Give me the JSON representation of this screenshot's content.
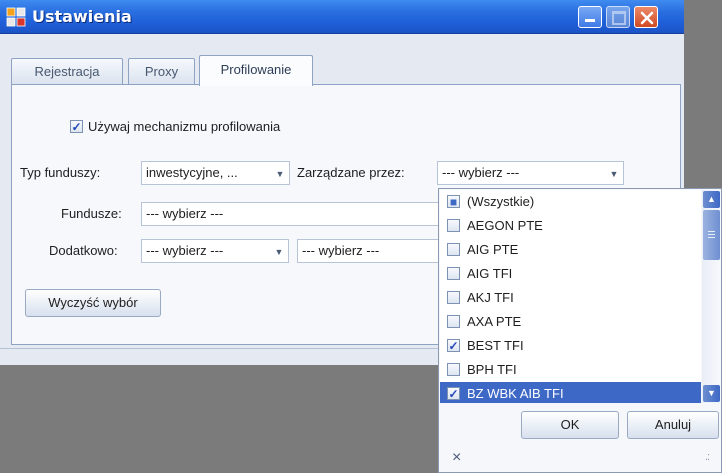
{
  "window": {
    "title": "Ustawienia"
  },
  "tabs": [
    {
      "label": "Rejestracja"
    },
    {
      "label": "Proxy"
    },
    {
      "label": "Profilowanie"
    }
  ],
  "profiling": {
    "use_mechanism_label": "Używaj mechanizmu profilowania",
    "use_mechanism_checked": true,
    "check_mark": "✓",
    "fund_type_label": "Typ funduszy:",
    "fund_type_value": "inwestycyjne, ...",
    "managed_by_label": "Zarządzane przez:",
    "managed_by_value": "--- wybierz ---",
    "funds_label": "Fundusze:",
    "funds_value": "--- wybierz ---",
    "additional_label": "Dodatkowo:",
    "additional_value_1": "--- wybierz ---",
    "additional_value_2": "--- wybierz ---",
    "clear_button": "Wyczyść wybór"
  },
  "dropdown": {
    "items": [
      {
        "label": "(Wszystkie)",
        "checked": "partial"
      },
      {
        "label": "AEGON PTE",
        "checked": false
      },
      {
        "label": "AIG PTE",
        "checked": false
      },
      {
        "label": "AIG TFI",
        "checked": false
      },
      {
        "label": "AKJ TFI",
        "checked": false
      },
      {
        "label": "AXA PTE",
        "checked": false
      },
      {
        "label": "BEST TFI",
        "checked": true
      },
      {
        "label": "BPH TFI",
        "checked": false
      },
      {
        "label": "BZ WBK AIB TFI",
        "checked": true,
        "selected": true
      }
    ],
    "ok_button": "OK",
    "cancel_button": "Anuluj",
    "close_glyph": "×",
    "grip_glyph": ".:"
  },
  "glyphs": {
    "combo_arrow": "▼",
    "scroll_up": "▲",
    "scroll_down": "▼"
  },
  "colors": {
    "titlebar": "#2a6fe0",
    "selection": "#3e68c6",
    "window_bg": "#e4e9f2"
  }
}
